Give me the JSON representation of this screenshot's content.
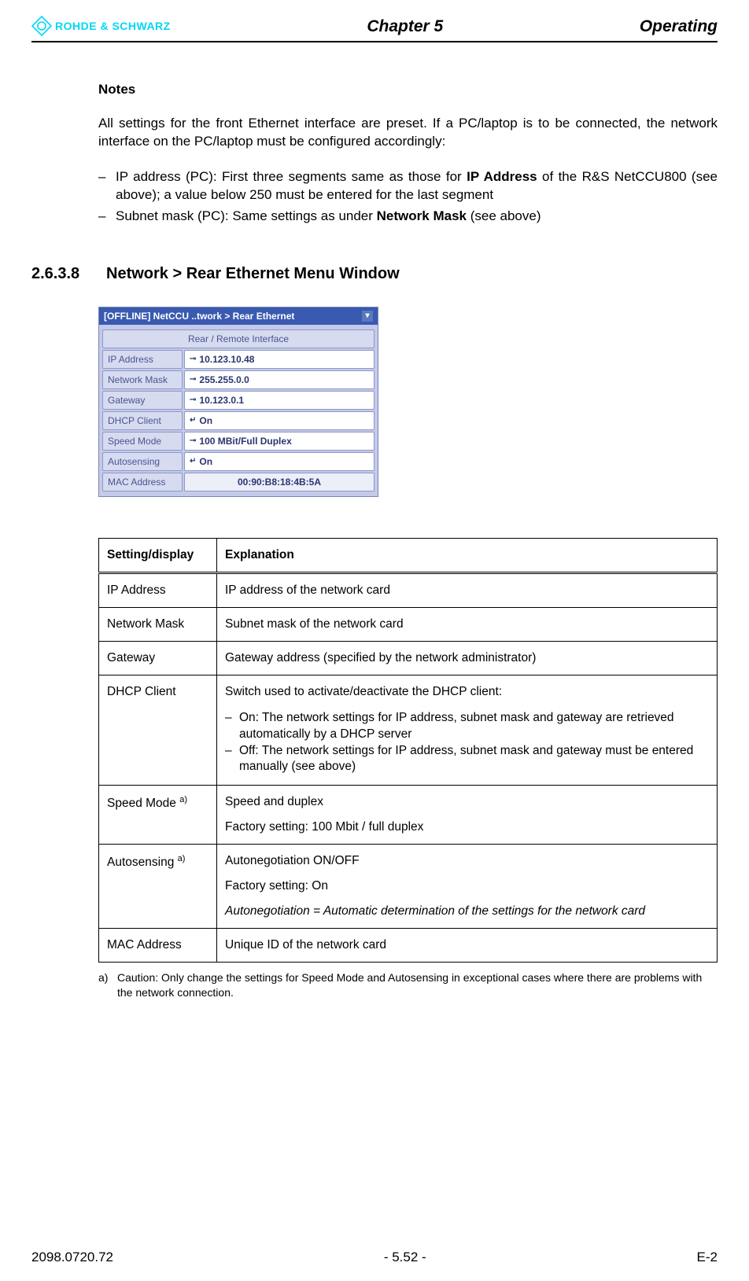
{
  "header": {
    "logo_text": "ROHDE & SCHWARZ",
    "chapter": "Chapter 5",
    "right": "Operating"
  },
  "notes": {
    "heading": "Notes",
    "para_prefix": "All settings for the front Ethernet interface are preset. If a PC/laptop is to be connected, the network interface on the PC/laptop must be configured accordingly:",
    "item1_a": "IP address (PC): First three segments same as those for ",
    "item1_b": "IP Address",
    "item1_c": " of the R&S NetCCU800 (see above); a value below 250 must be entered for the last segment",
    "item2_a": "Subnet mask (PC): Same settings as under ",
    "item2_b": "Network Mask",
    "item2_c": " (see above)"
  },
  "section": {
    "num": "2.6.3.8",
    "title": "Network > Rear Ethernet Menu Window"
  },
  "menu": {
    "title": "[OFFLINE] NetCCU ..twork > Rear Ethernet",
    "group": "Rear / Remote Interface",
    "rows": {
      "ip": {
        "label": "IP Address",
        "value": "10.123.10.48"
      },
      "mask": {
        "label": "Network Mask",
        "value": "255.255.0.0"
      },
      "gw": {
        "label": "Gateway",
        "value": "10.123.0.1"
      },
      "dhcp": {
        "label": "DHCP Client",
        "value": "On"
      },
      "speed": {
        "label": "Speed Mode",
        "value": "100 MBit/Full Duplex"
      },
      "auto": {
        "label": "Autosensing",
        "value": "On"
      },
      "mac": {
        "label": "MAC Address",
        "value": "00:90:B8:18:4B:5A"
      }
    }
  },
  "table": {
    "head_setting": "Setting/display",
    "head_expl": "Explanation",
    "rows": {
      "ip": {
        "s": "IP Address",
        "e": "IP address of the network card"
      },
      "mask": {
        "s": "Network Mask",
        "e": "Subnet mask of the network card"
      },
      "gw": {
        "s": "Gateway",
        "e": "Gateway address (specified by the network administrator)"
      },
      "dhcp": {
        "s": "DHCP Client",
        "p1": "Switch used to activate/deactivate the DHCP client:",
        "li1": "On: The network settings for IP address, subnet mask and gateway are retrieved automatically by a DHCP server",
        "li2": "Off: The network settings for IP address, subnet mask and gateway must be entered manually (see above)"
      },
      "speed": {
        "s": "Speed Mode ",
        "sup": "a)",
        "p1": "Speed and duplex",
        "p2": "Factory setting: 100 Mbit / full duplex"
      },
      "auto": {
        "s": "Autosensing ",
        "sup": "a)",
        "p1": "Autonegotiation ON/OFF",
        "p2": "Factory setting: On",
        "p3": "Autonegotiation = Automatic determination of the settings for the network card"
      },
      "mac": {
        "s": "MAC Address",
        "e": "Unique ID of the network card"
      }
    }
  },
  "footnote": {
    "marker": "a)",
    "text": "Caution: Only change the settings for Speed Mode and Autosensing in exceptional cases where there are problems with the network connection."
  },
  "footer": {
    "left": "2098.0720.72",
    "center": "- 5.52 -",
    "right": "E-2"
  }
}
